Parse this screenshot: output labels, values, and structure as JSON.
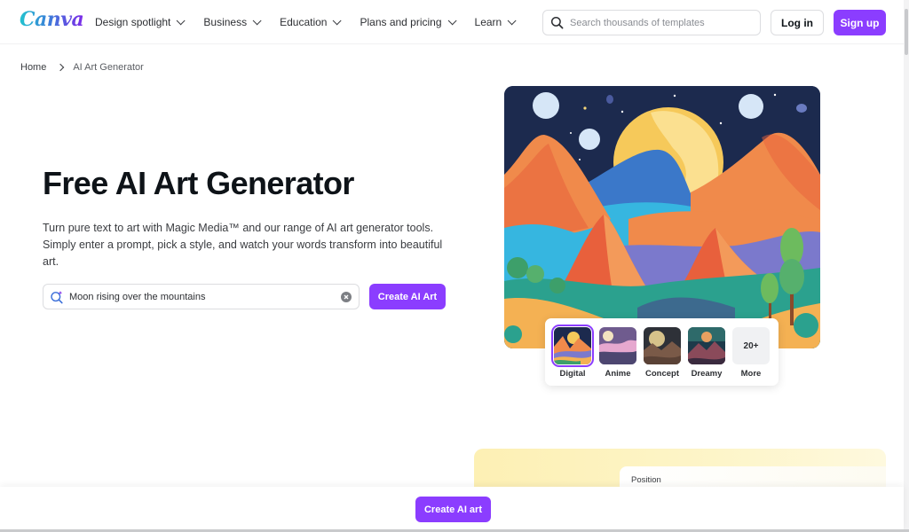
{
  "header": {
    "logo": "Canva",
    "nav": [
      {
        "label": "Design spotlight"
      },
      {
        "label": "Business"
      },
      {
        "label": "Education"
      },
      {
        "label": "Plans and pricing"
      },
      {
        "label": "Learn"
      }
    ],
    "search_placeholder": "Search thousands of templates",
    "login_label": "Log in",
    "signup_label": "Sign up"
  },
  "breadcrumb": {
    "items": [
      {
        "label": "Home"
      },
      {
        "label": "AI Art Generator"
      }
    ]
  },
  "hero": {
    "title": "Free AI Art Generator",
    "description": "Turn pure text to art with Magic Media™ and our range of AI art generator tools. Simply enter a prompt, pick a style, and watch your words transform into beautiful art.",
    "prompt_value": "Moon rising over the mountains",
    "create_label": "Create AI Art"
  },
  "styles": {
    "selected": "Digital",
    "items": [
      {
        "label": "Digital"
      },
      {
        "label": "Anime"
      },
      {
        "label": "Concept"
      },
      {
        "label": "Dreamy"
      },
      {
        "label": "More",
        "badge": "20+"
      }
    ]
  },
  "lower": {
    "position_label": "Position"
  },
  "footer": {
    "create_label": "Create AI art"
  },
  "colors": {
    "brand_purple": "#8b3dff",
    "text_primary": "#0e1318",
    "art_sky": "#1c2a4e"
  }
}
